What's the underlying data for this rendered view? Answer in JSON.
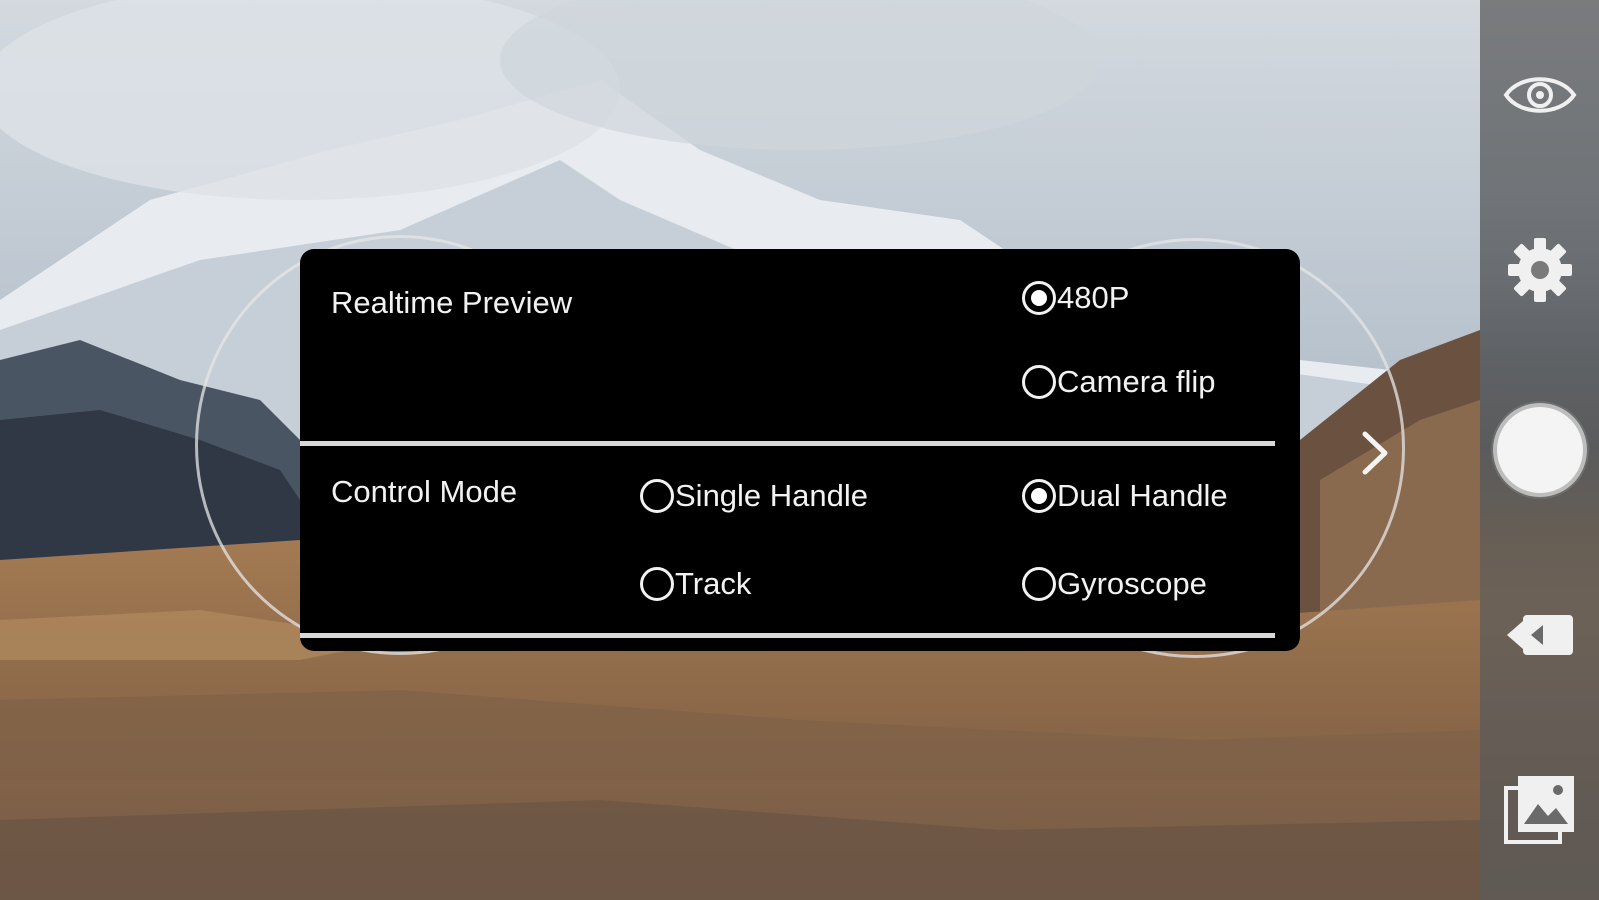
{
  "realtime_preview": {
    "label": "Realtime Preview",
    "options": [
      {
        "label": "480P",
        "checked": true
      },
      {
        "label": "Camera flip",
        "checked": false
      }
    ]
  },
  "control_mode": {
    "label": "Control Mode",
    "options": [
      {
        "label": "Single Handle",
        "checked": false
      },
      {
        "label": "Dual Handle",
        "checked": true
      },
      {
        "label": "Track",
        "checked": false
      },
      {
        "label": "Gyroscope",
        "checked": false
      }
    ]
  },
  "toolbar": {
    "icons": [
      "eye-icon",
      "gear-icon",
      "shutter-button",
      "video-icon",
      "gallery-icon"
    ]
  },
  "colors": {
    "panel_bg": "#000000",
    "toolbar_bg": "#5a5a5a",
    "text": "#f2f2f2"
  }
}
